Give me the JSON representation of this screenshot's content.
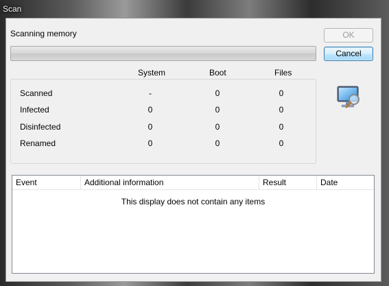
{
  "window": {
    "title": "Scan"
  },
  "scan": {
    "status_label": "Scanning memory",
    "progress_fraction": 0.0
  },
  "buttons": {
    "ok": "OK",
    "cancel": "Cancel"
  },
  "stats": {
    "columns": [
      "System",
      "Boot",
      "Files"
    ],
    "rows": [
      {
        "label": "Scanned",
        "values": [
          "-",
          "0",
          "0"
        ]
      },
      {
        "label": "Infected",
        "values": [
          "0",
          "0",
          "0"
        ]
      },
      {
        "label": "Disinfected",
        "values": [
          "0",
          "0",
          "0"
        ]
      },
      {
        "label": "Renamed",
        "values": [
          "0",
          "0",
          "0"
        ]
      }
    ]
  },
  "icons": {
    "scan": "monitor-magnifier-icon"
  },
  "events": {
    "columns": [
      "Event",
      "Additional information",
      "Result",
      "Date"
    ],
    "empty_message": "This display does not contain any items"
  }
}
